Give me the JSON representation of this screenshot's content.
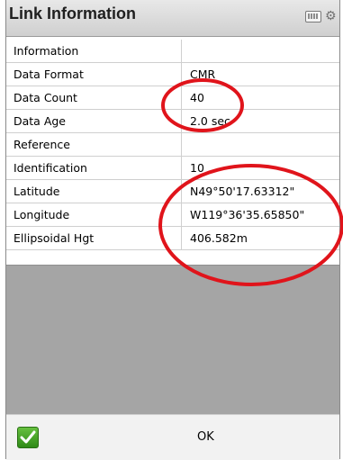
{
  "window": {
    "title": "Link Information",
    "title_icons": [
      "keyboard-icon",
      "gear-icon"
    ]
  },
  "rows": [
    {
      "label": "Information",
      "value": ""
    },
    {
      "label": "Data Format",
      "value": "CMR"
    },
    {
      "label": "Data Count",
      "value": "40"
    },
    {
      "label": "Data Age",
      "value": "2.0 sec"
    },
    {
      "label": "Reference",
      "value": ""
    },
    {
      "label": "Identification",
      "value": "10"
    },
    {
      "label": "Latitude",
      "value": "N49°50'17.63312\""
    },
    {
      "label": "Longitude",
      "value": "W119°36'35.65850\""
    },
    {
      "label": "Ellipsoidal Hgt",
      "value": "406.582m"
    }
  ],
  "bottom": {
    "ok_label": "OK",
    "check_icon": "checkmark-icon"
  },
  "annotation_color": "#e0141b"
}
